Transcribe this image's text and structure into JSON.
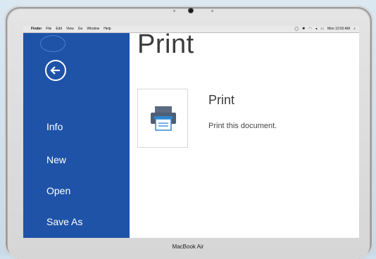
{
  "menubar": {
    "apple_glyph": "",
    "app_name": "Finder",
    "items": [
      "File",
      "Edit",
      "View",
      "Go",
      "Window",
      "Help"
    ],
    "clock": "Mon 10:50 AM",
    "status_icons": [
      "airplay-icon",
      "bluetooth-icon",
      "wifi-icon",
      "volume-icon",
      "battery-icon"
    ],
    "search_icon": "search-icon"
  },
  "sidebar": {
    "back_icon": "back-arrow-icon",
    "items": [
      {
        "label": "Info"
      },
      {
        "label": "New"
      },
      {
        "label": "Open"
      },
      {
        "label": "Save As"
      }
    ],
    "background_color": "#1e53a8"
  },
  "main": {
    "title": "Print",
    "print_tile": {
      "icon": "printer-icon"
    },
    "print_heading": "Print",
    "print_description": "Print this document."
  },
  "device": {
    "brand_label": "MacBook Air"
  }
}
